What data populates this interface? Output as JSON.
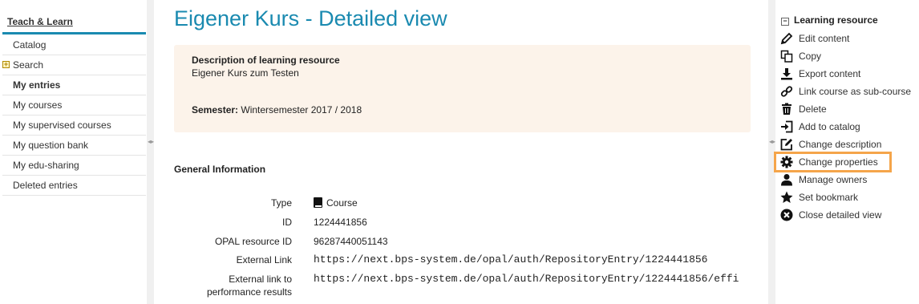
{
  "left_nav": {
    "title": "Teach & Learn",
    "items": [
      {
        "label": "Catalog"
      },
      {
        "label": "Search"
      },
      {
        "label": "My entries"
      },
      {
        "label": "My courses"
      },
      {
        "label": "My supervised courses"
      },
      {
        "label": "My question bank"
      },
      {
        "label": "My edu-sharing"
      },
      {
        "label": "Deleted entries"
      }
    ]
  },
  "main": {
    "title": "Eigener Kurs - Detailed view",
    "description_label": "Description of learning resource",
    "description_text": "Eigener Kurs zum Testen",
    "semester_label": "Semester:",
    "semester_value": "Wintersemester 2017 / 2018",
    "general_info_title": "General Information",
    "info": {
      "type_label": "Type",
      "type_value": "Course",
      "id_label": "ID",
      "id_value": "1224441856",
      "opal_label": "OPAL resource ID",
      "opal_value": "96287440051143",
      "ext_link_label": "External Link",
      "ext_link_value": "https://next.bps-system.de/opal/auth/RepositoryEntry/1224441856",
      "ext_perf_label_1": "External link to",
      "ext_perf_label_2": "performance results",
      "ext_perf_value": "https://next.bps-system.de/opal/auth/RepositoryEntry/1224441856/effi"
    }
  },
  "right_panel": {
    "title": "Learning resource",
    "actions": [
      {
        "label": "Edit content",
        "icon": "pencil-icon"
      },
      {
        "label": "Copy",
        "icon": "copy-icon"
      },
      {
        "label": "Export content",
        "icon": "download-icon"
      },
      {
        "label": "Link course as sub-course",
        "icon": "link-icon"
      },
      {
        "label": "Delete",
        "icon": "trash-icon"
      },
      {
        "label": "Add to catalog",
        "icon": "sign-in-icon"
      },
      {
        "label": "Change description",
        "icon": "edit-icon"
      },
      {
        "label": "Change properties",
        "icon": "gear-icon"
      },
      {
        "label": "Manage owners",
        "icon": "user-icon"
      },
      {
        "label": "Set bookmark",
        "icon": "star-icon"
      },
      {
        "label": "Close detailed view",
        "icon": "close-icon"
      }
    ],
    "highlight_color": "#f5a54a"
  },
  "colors": {
    "accent": "#1a8ab0",
    "description_bg": "#fcf3ea"
  }
}
